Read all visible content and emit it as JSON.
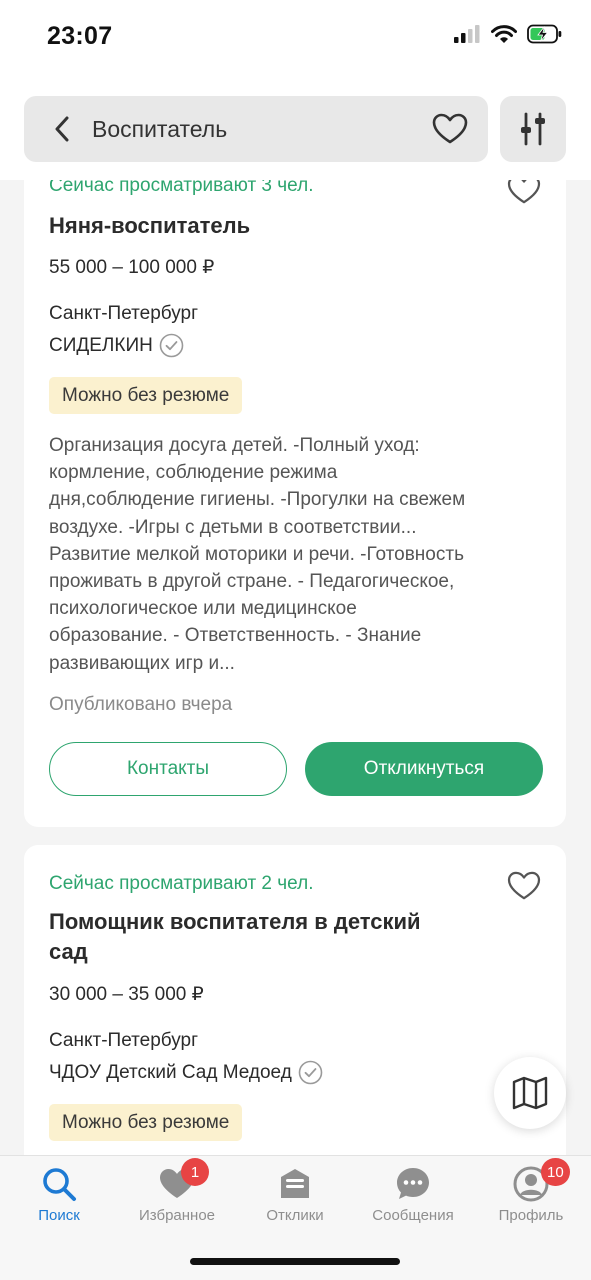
{
  "status_bar": {
    "time": "23:07"
  },
  "header": {
    "search_text": "Воспитатель",
    "icons": {
      "back": "chevron-left-icon",
      "favorite": "heart-outline-icon",
      "filter": "filter-sliders-icon"
    }
  },
  "vacancies": [
    {
      "viewers": "Сейчас просматривают 3 чел.",
      "title": "Няня-воспитатель",
      "salary": "55 000 – 100 000 ₽",
      "city": "Санкт-Петербург",
      "company": "СИДЕЛКИН",
      "badge": "Можно без резюме",
      "description_lines": [
        "Организация досуга детей. -Полный уход:",
        "кормление, соблюдение режима",
        "дня,соблюдение гигиены. -Прогулки на свежем",
        "воздухе. -Игры с детьми в соответствии...",
        "Развитие мелкой моторики и речи. -Готовность",
        "проживать в другой стране. - Педагогическое,",
        "психологическое или медицинское",
        "образование. - Ответственность. - Знание",
        "развивающих игр и..."
      ],
      "published": "Опубликовано вчера",
      "contacts_label": "Контакты",
      "respond_label": "Откликнуться"
    },
    {
      "viewers": "Сейчас просматривают 2 чел.",
      "title_lines": [
        "Помощник воспитателя в детский",
        "сад"
      ],
      "salary": "30 000 – 35 000 ₽",
      "city": "Санкт-Петербург",
      "company": "ЧДОУ Детский Сад Медоед",
      "badge": "Можно без резюме"
    }
  ],
  "map_button": {
    "icon": "map-icon"
  },
  "bottom_nav": {
    "items": [
      {
        "label": "Поиск",
        "icon": "search-icon",
        "active": true
      },
      {
        "label": "Избранное",
        "icon": "heart-filled-icon",
        "badge": "1"
      },
      {
        "label": "Отклики",
        "icon": "inbox-icon"
      },
      {
        "label": "Сообщения",
        "icon": "chat-bubble-icon"
      },
      {
        "label": "Профиль",
        "icon": "user-icon",
        "badge": "10"
      }
    ]
  },
  "colors": {
    "accent": "#2ea56f",
    "nav_active": "#1e7ad3",
    "badge_bg": "#fbf1cf",
    "notification": "#e74444"
  }
}
